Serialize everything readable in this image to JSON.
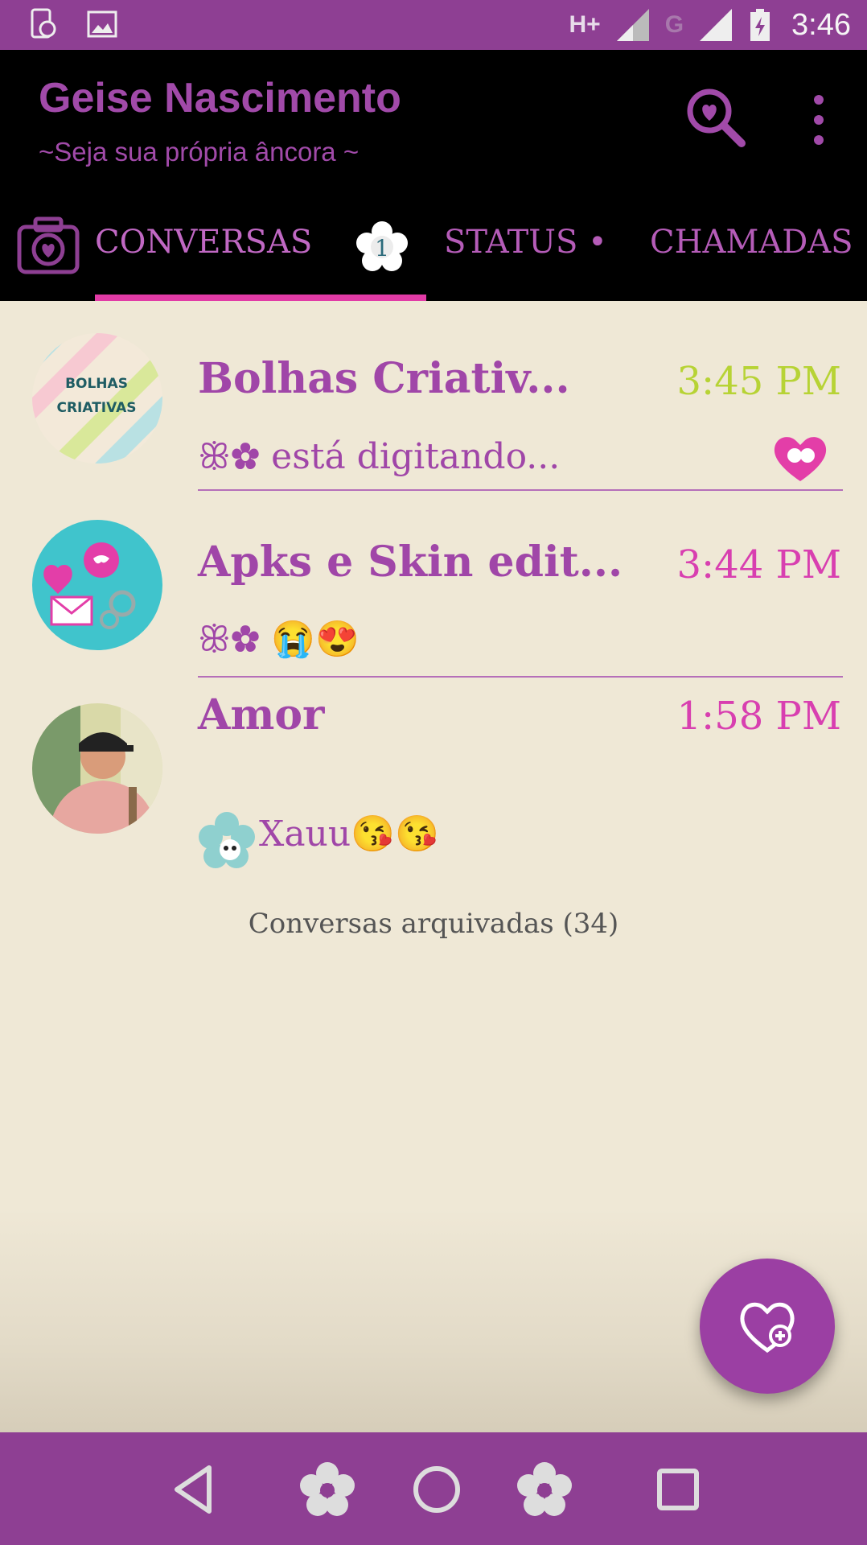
{
  "statusbar": {
    "network1": "H+",
    "network2": "G",
    "time": "3:46"
  },
  "appbar": {
    "title": "Geise Nascimento",
    "subtitle": "~Seja sua própria âncora ~"
  },
  "tabs": [
    {
      "label": "CONVERSAS",
      "badge": "1"
    },
    {
      "label": "STATUS •"
    },
    {
      "label": "CHAMADAS"
    }
  ],
  "chats": [
    {
      "name": "Bolhas Criativ...",
      "time": "3:45 PM",
      "message": "ꕥ✿ está digitando...",
      "time_color": "#b7d335",
      "avatar_text1": "BOLHAS",
      "avatar_text2": "CRIATIVAS"
    },
    {
      "name": "Apks e Skin edit...",
      "time": "3:44 PM",
      "message": "ꕥ✿ 😭😍",
      "time_color": "#d83fb0"
    },
    {
      "name": "Amor",
      "time": "1:58 PM",
      "message": "Xauu😘😘",
      "time_color": "#d83fb0"
    }
  ],
  "archived": "Conversas arquivadas (34)",
  "colors": {
    "primary": "#8e3f93",
    "accent": "#e23ba6",
    "background": "#efe8d6",
    "text": "#a046a8"
  }
}
